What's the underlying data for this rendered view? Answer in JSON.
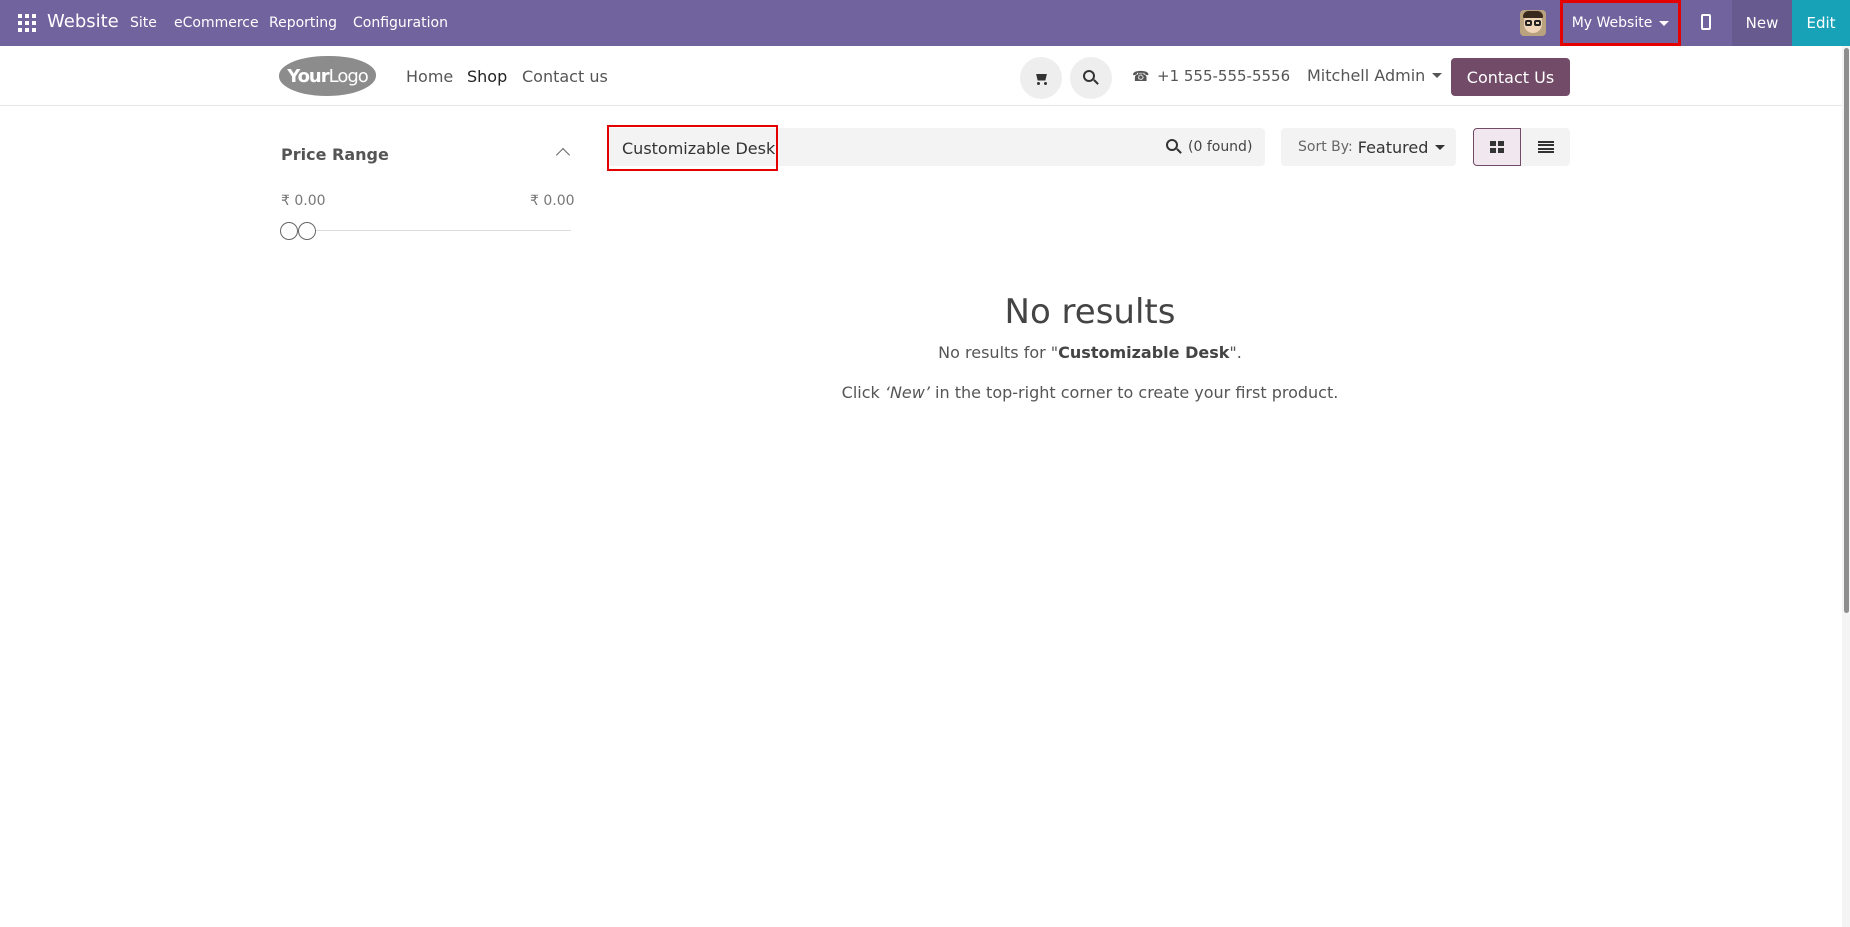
{
  "topbar": {
    "brand": "Website",
    "menu": [
      "Site",
      "eCommerce",
      "Reporting",
      "Configuration"
    ],
    "website_switcher": "My Website",
    "new_label": "New",
    "edit_label": "Edit"
  },
  "header": {
    "logo": {
      "bold": "Your",
      "light": "Logo"
    },
    "nav": [
      "Home",
      "Shop",
      "Contact us"
    ],
    "phone": "+1 555-555-5556",
    "user": "Mitchell Admin",
    "contact_button": "Contact Us"
  },
  "sidebar": {
    "price_title": "Price Range",
    "price_min": "₹ 0.00",
    "price_max": "₹ 0.00"
  },
  "search": {
    "query": "Customizable Desk",
    "found": "(0 found)"
  },
  "sort": {
    "label": "Sort By:",
    "value": "Featured"
  },
  "results": {
    "title": "No results",
    "line_prefix": "No results for \"",
    "line_query": "Customizable Desk",
    "line_suffix": "\".",
    "hint_prefix": "Click ",
    "hint_new": "‘New’",
    "hint_suffix": " in the top-right corner to create your first product."
  },
  "colors": {
    "topbar": "#71639e",
    "edit": "#17a2b8",
    "primary": "#714b67",
    "highlight": "#e50000"
  }
}
